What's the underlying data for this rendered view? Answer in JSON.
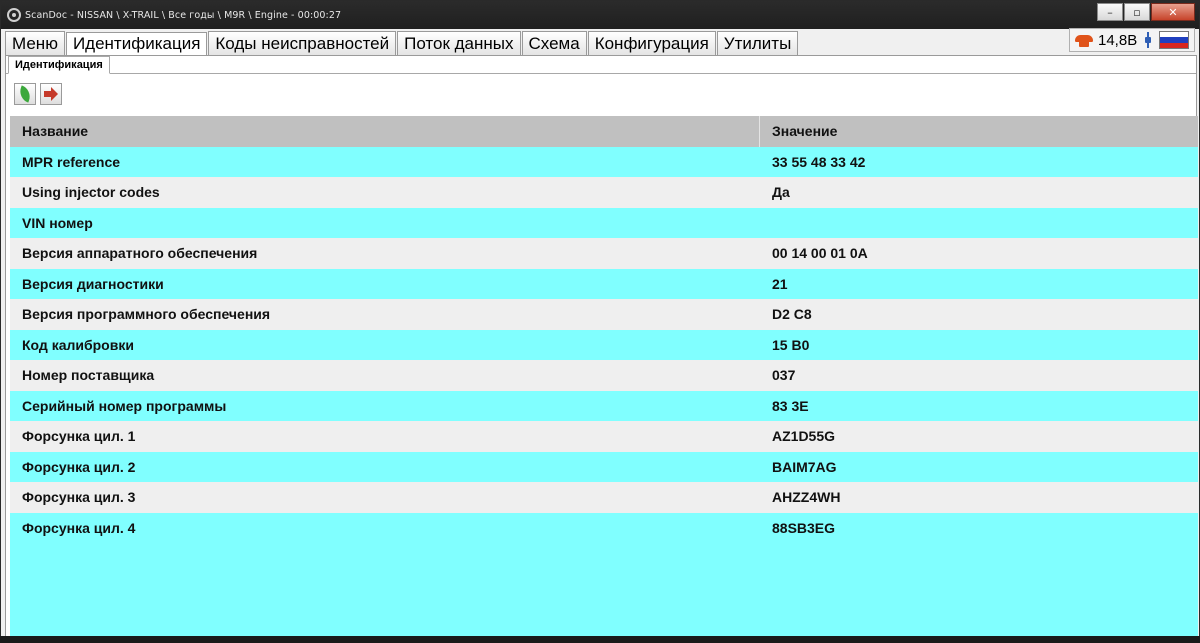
{
  "window": {
    "title": "ScanDoc - NISSAN \\ X-TRAIL \\ Все годы \\ M9R \\ Engine - 00:00:27"
  },
  "menu_tabs": [
    {
      "label": "Меню",
      "active": false
    },
    {
      "label": "Идентификация",
      "active": true
    },
    {
      "label": "Коды неисправностей",
      "active": false
    },
    {
      "label": "Поток данных",
      "active": false
    },
    {
      "label": "Схема",
      "active": false
    },
    {
      "label": "Конфигурация",
      "active": false
    },
    {
      "label": "Утилиты",
      "active": false
    }
  ],
  "status": {
    "voltage": "14,8В",
    "icons": [
      "phone-icon",
      "plug-icon",
      "russia-flag-icon"
    ],
    "flag_colors": [
      "#ffffff",
      "#1f3fbf",
      "#d7261f"
    ]
  },
  "subtab": {
    "label": "Идентификация"
  },
  "toolbar": {
    "icons": [
      "leaf-icon",
      "export-arrow-icon"
    ]
  },
  "table": {
    "headers": {
      "name": "Название",
      "value": "Значение"
    },
    "rows": [
      {
        "name": "MPR reference",
        "value": "33 55 48 33 42"
      },
      {
        "name": "Using injector codes",
        "value": "Да"
      },
      {
        "name": "VIN номер",
        "value": ""
      },
      {
        "name": "Версия аппаратного обеспечения",
        "value": "00 14 00 01 0A"
      },
      {
        "name": "Версия диагностики",
        "value": "21"
      },
      {
        "name": "Версия программного обеспечения",
        "value": "D2 C8"
      },
      {
        "name": "Код калибровки",
        "value": "15 B0"
      },
      {
        "name": "Номер поставщика",
        "value": "037"
      },
      {
        "name": "Серийный номер программы",
        "value": "83 3E"
      },
      {
        "name": "Форсунка цил. 1",
        "value": "AZ1D55G"
      },
      {
        "name": "Форсунка цил. 2",
        "value": "BAIM7AG"
      },
      {
        "name": "Форсунка цил. 3",
        "value": "AHZZ4WH"
      },
      {
        "name": "Форсунка цил. 4",
        "value": "88SB3EG"
      }
    ],
    "colors": {
      "header": "#c0c0c0",
      "cyan_row": "#80ffff",
      "gray_row": "#efefef"
    }
  }
}
